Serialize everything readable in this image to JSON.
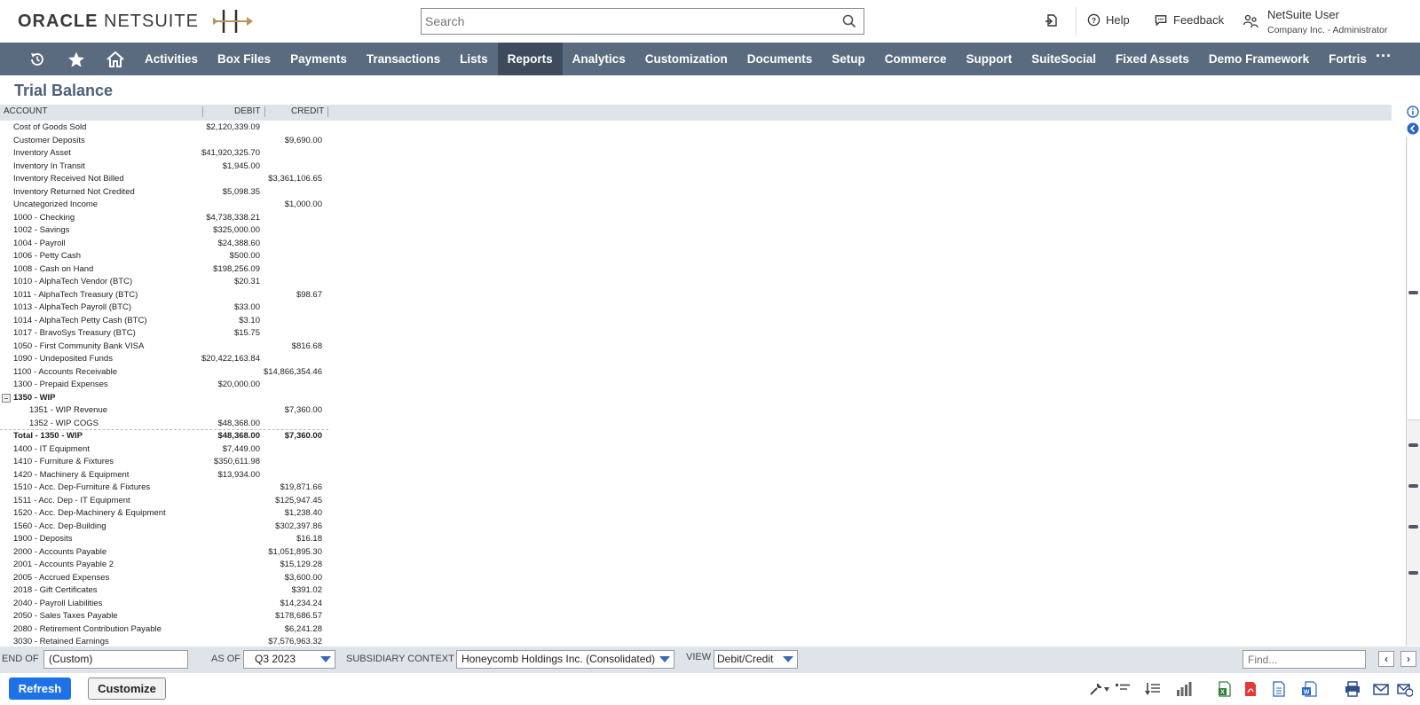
{
  "header": {
    "logo_oracle": "ORACLE",
    "logo_netsuite": "NETSUITE",
    "search_placeholder": "Search",
    "help": "Help",
    "feedback": "Feedback",
    "user_name": "NetSuite User",
    "user_role": "Company Inc. - Administrator"
  },
  "nav": {
    "items": [
      "Activities",
      "Box Files",
      "Payments",
      "Transactions",
      "Lists",
      "Reports",
      "Analytics",
      "Customization",
      "Documents",
      "Setup",
      "Commerce",
      "Support",
      "SuiteSocial",
      "Fixed Assets",
      "Demo Framework",
      "Fortris"
    ],
    "active": "Reports",
    "more": "···"
  },
  "page": {
    "title": "Trial Balance"
  },
  "table": {
    "columns": {
      "account": "ACCOUNT",
      "debit": "DEBIT",
      "credit": "CREDIT"
    },
    "rows": [
      {
        "account": "Cost of Goods Sold",
        "debit": "$2,120,339.09",
        "credit": ""
      },
      {
        "account": "Customer Deposits",
        "debit": "",
        "credit": "$9,690.00"
      },
      {
        "account": "Inventory Asset",
        "debit": "$41,920,325.70",
        "credit": ""
      },
      {
        "account": "Inventory In Transit",
        "debit": "$1,945.00",
        "credit": ""
      },
      {
        "account": "Inventory Received Not Billed",
        "debit": "",
        "credit": "$3,361,106.65"
      },
      {
        "account": "Inventory Returned Not Credited",
        "debit": "$5,098.35",
        "credit": ""
      },
      {
        "account": "Uncategorized Income",
        "debit": "",
        "credit": "$1,000.00"
      },
      {
        "account": "1000 - Checking",
        "debit": "$4,738,338.21",
        "credit": ""
      },
      {
        "account": "1002 - Savings",
        "debit": "$325,000.00",
        "credit": ""
      },
      {
        "account": "1004 - Payroll",
        "debit": "$24,388.60",
        "credit": ""
      },
      {
        "account": "1006 - Petty Cash",
        "debit": "$500.00",
        "credit": ""
      },
      {
        "account": "1008 - Cash on Hand",
        "debit": "$198,256.09",
        "credit": ""
      },
      {
        "account": "1010 - AlphaTech Vendor (BTC)",
        "debit": "$20.31",
        "credit": ""
      },
      {
        "account": "1011 - AlphaTech Treasury (BTC)",
        "debit": "",
        "credit": "$98.67"
      },
      {
        "account": "1013 - AlphaTech Payroll (BTC)",
        "debit": "$33.00",
        "credit": ""
      },
      {
        "account": "1014 - AlphaTech Petty Cash (BTC)",
        "debit": "$3.10",
        "credit": ""
      },
      {
        "account": "1017 - BravoSys Treasury (BTC)",
        "debit": "$15.75",
        "credit": ""
      },
      {
        "account": "1050 - First Community Bank VISA",
        "debit": "",
        "credit": "$816.68"
      },
      {
        "account": "1090 - Undeposited Funds",
        "debit": "$20,422,163.84",
        "credit": ""
      },
      {
        "account": "1100 - Accounts Receivable",
        "debit": "",
        "credit": "$14,866,354.46"
      },
      {
        "account": "1300 - Prepaid Expenses",
        "debit": "$20,000.00",
        "credit": ""
      },
      {
        "account": "1350 - WIP",
        "debit": "",
        "credit": "",
        "group": true
      },
      {
        "account": "1351 - WIP Revenue",
        "debit": "",
        "credit": "$7,360.00",
        "child": true
      },
      {
        "account": "1352 - WIP COGS",
        "debit": "$48,368.00",
        "credit": "",
        "child": true
      },
      {
        "account": "Total - 1350 - WIP",
        "debit": "$48,368.00",
        "credit": "$7,360.00",
        "total": true
      },
      {
        "account": "1400 - IT Equipment",
        "debit": "$7,449.00",
        "credit": ""
      },
      {
        "account": "1410 - Furniture & Fixtures",
        "debit": "$350,611.98",
        "credit": ""
      },
      {
        "account": "1420 - Machinery & Equipment",
        "debit": "$13,934.00",
        "credit": ""
      },
      {
        "account": "1510 - Acc. Dep-Furniture & Fixtures",
        "debit": "",
        "credit": "$19,871.66"
      },
      {
        "account": "1511 - Acc. Dep - IT Equipment",
        "debit": "",
        "credit": "$125,947.45"
      },
      {
        "account": "1520 - Acc. Dep-Machinery & Equipment",
        "debit": "",
        "credit": "$1,238.40"
      },
      {
        "account": "1560 - Acc. Dep-Building",
        "debit": "",
        "credit": "$302,397.86"
      },
      {
        "account": "1900 - Deposits",
        "debit": "",
        "credit": "$16.18"
      },
      {
        "account": "2000 - Accounts Payable",
        "debit": "",
        "credit": "$1,051,895.30"
      },
      {
        "account": "2001 - Accounts Payable 2",
        "debit": "",
        "credit": "$15,129.28"
      },
      {
        "account": "2005 - Accrued Expenses",
        "debit": "",
        "credit": "$3,600.00"
      },
      {
        "account": "2018 - Gift Certificates",
        "debit": "",
        "credit": "$391.02"
      },
      {
        "account": "2040 - Payroll Liabilities",
        "debit": "",
        "credit": "$14,234.24"
      },
      {
        "account": "2050 - Sales Taxes Payable",
        "debit": "",
        "credit": "$178,686.57"
      },
      {
        "account": "2080 - Retirement Contribution Payable",
        "debit": "",
        "credit": "$6,241.28"
      },
      {
        "account": "3030 - Retained Earnings",
        "debit": "",
        "credit": "$7,576,963.32"
      }
    ]
  },
  "filters": {
    "end_of_label": "END OF",
    "end_of_value": "(Custom)",
    "as_of_label": "AS OF",
    "as_of_value": "Q3 2023",
    "subsidiary_label": "SUBSIDIARY CONTEXT",
    "subsidiary_value": "Honeycomb Holdings Inc. (Consolidated)",
    "view_label": "VIEW",
    "view_value": "Debit/Credit",
    "find_placeholder": "Find..."
  },
  "actions": {
    "refresh": "Refresh",
    "customize": "Customize"
  }
}
